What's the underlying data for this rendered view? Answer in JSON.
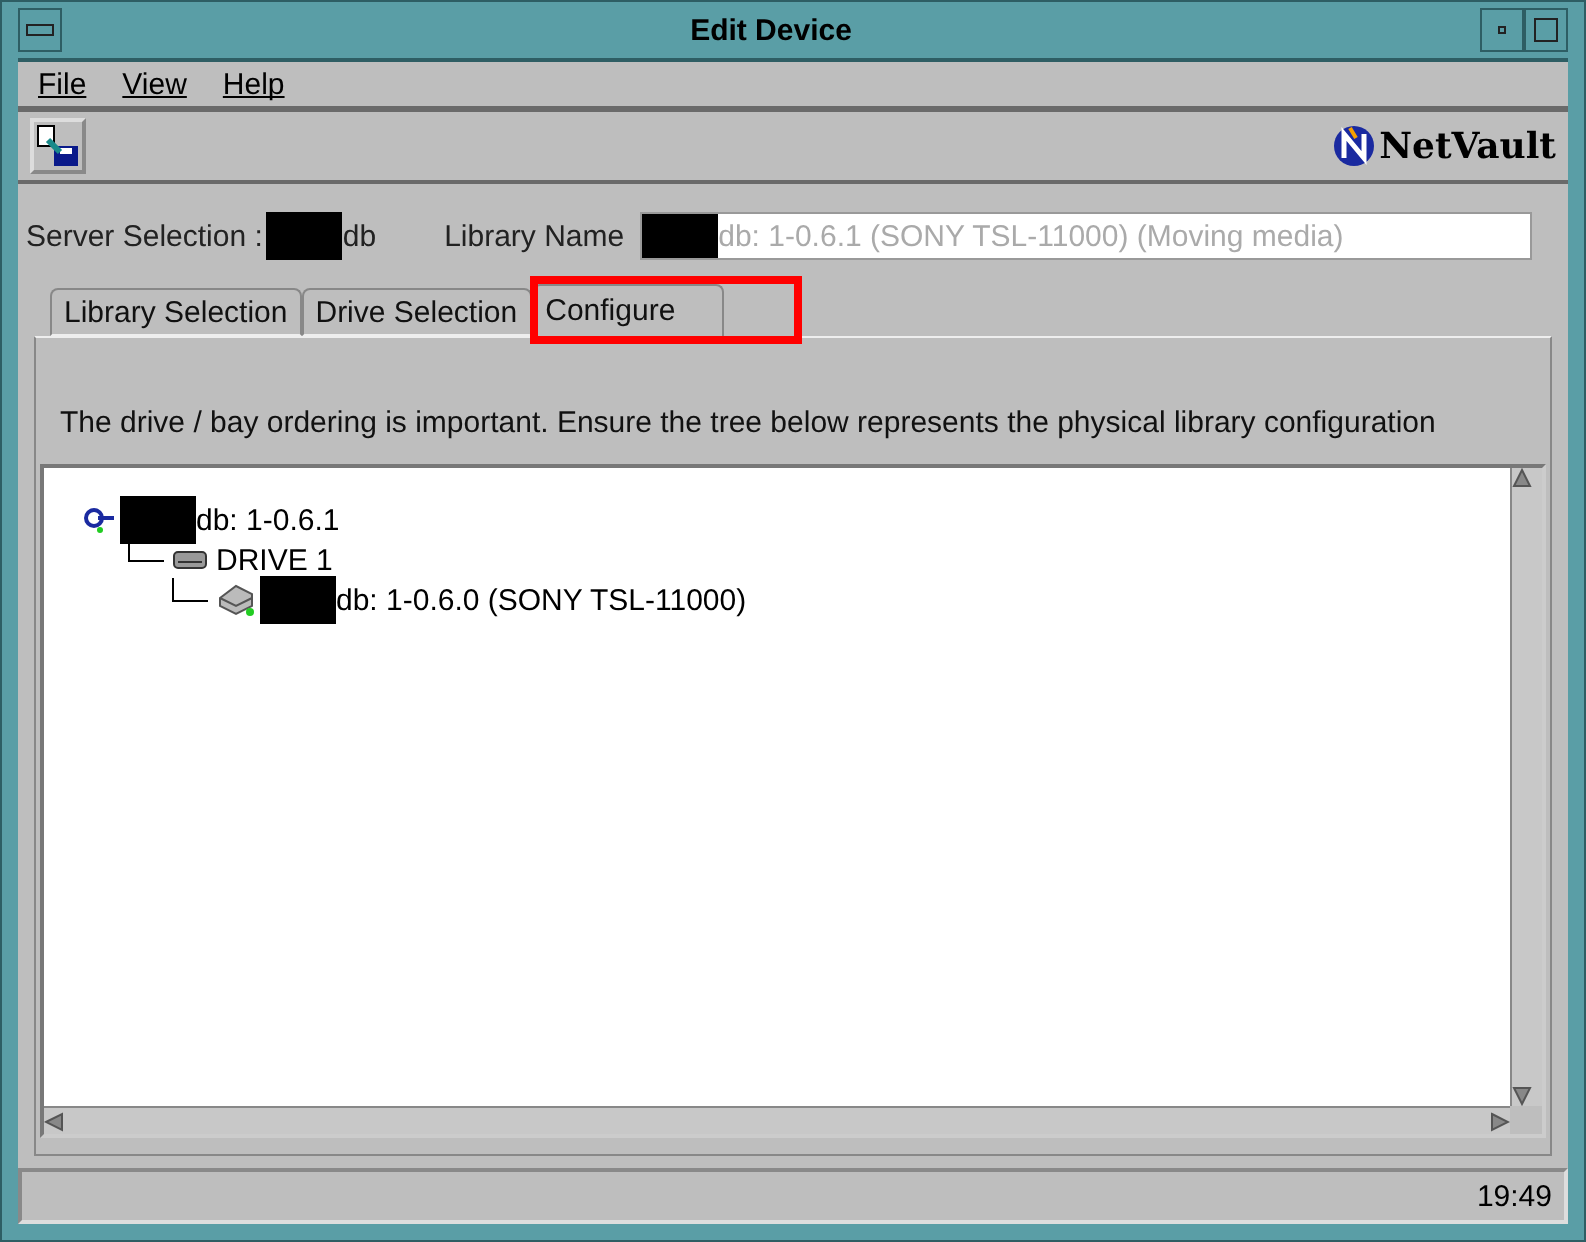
{
  "window": {
    "title": "Edit Device"
  },
  "menu": [
    "File",
    "View",
    "Help"
  ],
  "logo": {
    "text": "NetVault"
  },
  "server": {
    "label": "Server Selection :",
    "value": "db"
  },
  "library": {
    "label": "Library Name",
    "value": "db: 1-0.6.1 (SONY TSL-11000) (Moving media)",
    "disabled": true
  },
  "tabs": [
    {
      "label": "Library Selection",
      "selected": false
    },
    {
      "label": "Drive Selection",
      "selected": false
    },
    {
      "label": "Configure",
      "selected": true,
      "highlighted": true
    }
  ],
  "instruction": "The drive / bay ordering is important. Ensure the tree below represents the physical library configuration",
  "tree": [
    {
      "kind": "library",
      "label": "db: 1-0.6.1",
      "redacted": true,
      "children": [
        {
          "kind": "bay",
          "label": "DRIVE 1",
          "redacted": false,
          "children": [
            {
              "kind": "drive",
              "label": "db: 1-0.6.0 (SONY TSL-11000)",
              "redacted": true
            }
          ]
        }
      ]
    }
  ],
  "status_bar": {
    "time": "19:49"
  }
}
